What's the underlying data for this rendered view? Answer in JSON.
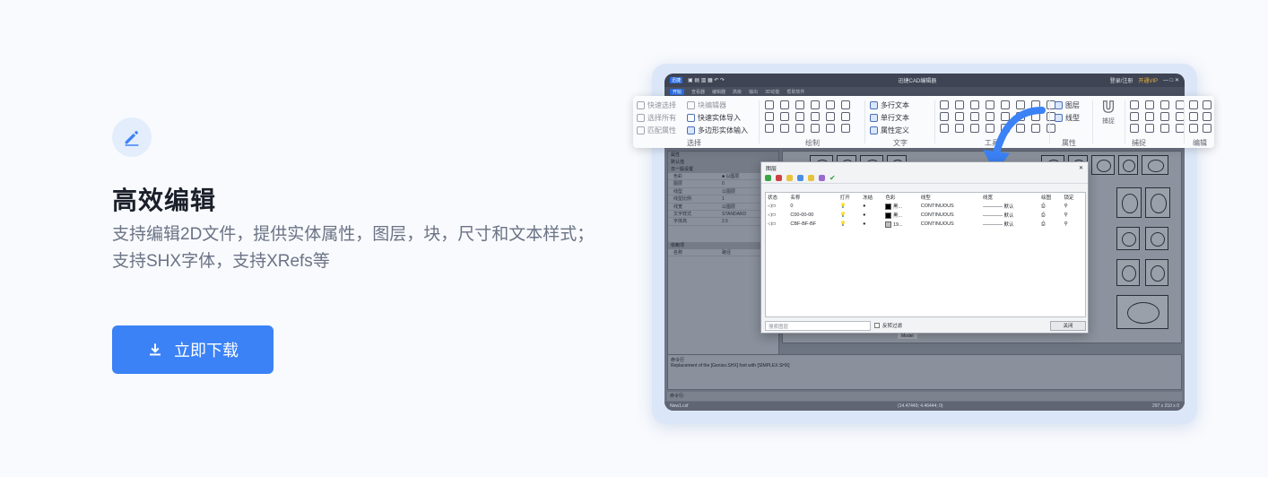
{
  "feature": {
    "title": "高效编辑",
    "description": "支持编辑2D文件，提供实体属性，图层，块，尺寸和文本样式；支持SHX字体，支持XRefs等",
    "download_label": "立即下载"
  },
  "app": {
    "logo": "迅捷",
    "title": "迅捷CAD编辑器",
    "login": "登录/注册",
    "vip": "开通VIP",
    "tabs": [
      "开始",
      "查看器",
      "编辑器",
      "高级",
      "输出",
      "3D动能",
      "帮助软件"
    ],
    "props_header": "属性",
    "props_default": "默认值",
    "props_group": "日一般设置",
    "props": [
      {
        "k": "色彩",
        "v": "■ 以图层"
      },
      {
        "k": "图层",
        "v": "0"
      },
      {
        "k": "线型",
        "v": "以图层"
      },
      {
        "k": "线型比例",
        "v": "1"
      },
      {
        "k": "线宽",
        "v": "以图层"
      },
      {
        "k": "文字样式",
        "v": "STANDARD"
      },
      {
        "k": "字体高",
        "v": "2.5"
      }
    ],
    "attach_header": "依赖项",
    "attach_cols": [
      "名称",
      "路径"
    ],
    "model_tab": "Model",
    "cmd_header": "命令行",
    "cmd_text": "Replacement of the [Geniso.SHX] font with [SIMPLEX.SHX]",
    "cmd_label": "命令行:",
    "status_file": "New1.cxf",
    "status_coords": "(14.47449; 4.46444; 0)",
    "status_size": "297 x 210 x 0"
  },
  "ribbon": {
    "select": {
      "items": [
        "快速选择",
        "选择所有",
        "匹配属性"
      ],
      "label": "选择"
    },
    "block": {
      "items": [
        "块编辑器",
        "快速实体导入",
        "多边形实体输入"
      ]
    },
    "draw_label": "绘制",
    "text": {
      "items": [
        "多行文本",
        "单行文本",
        "属性定义"
      ],
      "label": "文字"
    },
    "tools_label": "工具",
    "props": {
      "items": [
        "图层",
        "线型"
      ],
      "label": "属性"
    },
    "snap": {
      "item": "捕捉",
      "label": "捕捉"
    },
    "edit_label": "编辑"
  },
  "layer_dialog": {
    "title": "图层",
    "columns": [
      "状态",
      "名称",
      "打开",
      "冻结",
      "色彩",
      "线型",
      "线宽",
      "绘图",
      "锁定"
    ],
    "rows": [
      {
        "name": "0",
        "color": "黑...",
        "linetype": "CONTINUOUS",
        "lineweight": "———— 默认"
      },
      {
        "name": "C00-00-00",
        "color": "黑...",
        "linetype": "CONTINUOUS",
        "lineweight": "———— 默认"
      },
      {
        "name": "CBF-BF-BF",
        "color": "19...",
        "linetype": "CONTINUOUS",
        "lineweight": "———— 默认"
      }
    ],
    "search_placeholder": "搜索图层",
    "invert_filter": "反转过滤",
    "close_label": "关闭"
  },
  "colors": {
    "accent": "#3b82f6",
    "icon_bg": "#e3edfc",
    "frame": "#dbe7f8"
  }
}
